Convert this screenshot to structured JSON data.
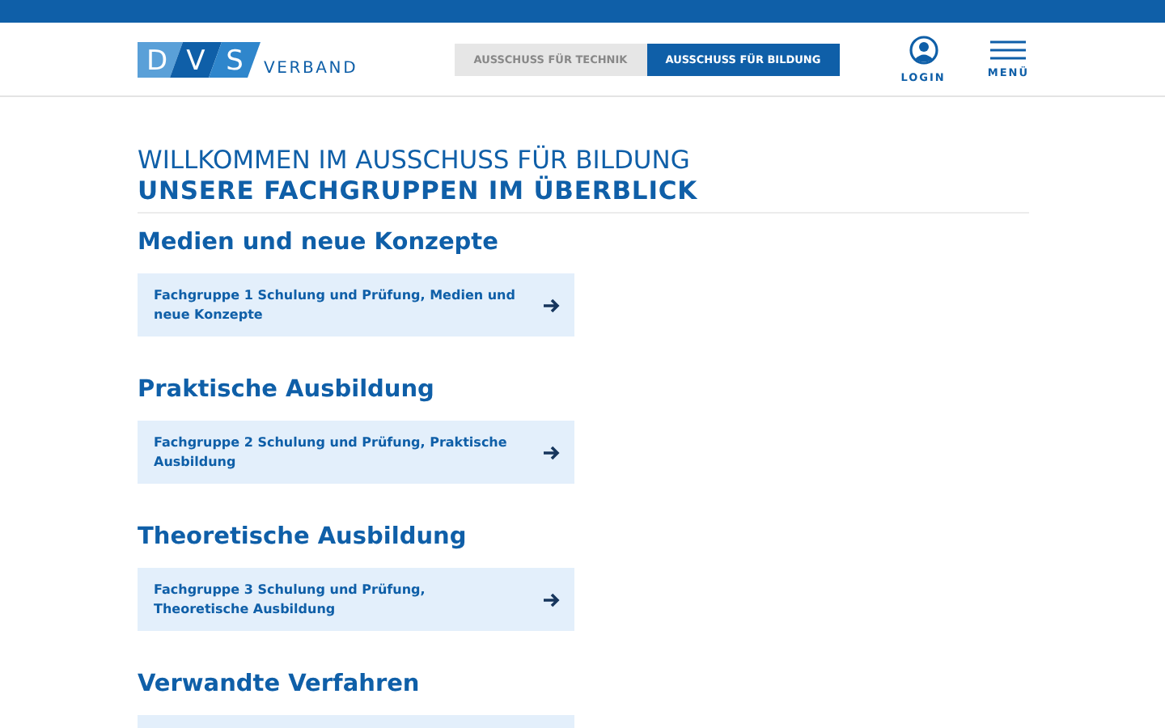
{
  "header": {
    "logo": {
      "letters": [
        "D",
        "V",
        "S"
      ],
      "word": "VERBAND"
    },
    "tabs": [
      {
        "label": "AUSSCHUSS FÜR TECHNIK",
        "selected": false
      },
      {
        "label": "AUSSCHUSS FÜR BILDUNG",
        "selected": true
      }
    ],
    "login": "LOGIN",
    "menu": "MENÜ"
  },
  "title": {
    "line1": "WILLKOMMEN IM AUSSCHUSS FÜR BILDUNG",
    "line2": "UNSERE FACHGRUPPEN IM ÜBERBLICK"
  },
  "sections": [
    {
      "heading": "Medien und neue Konzepte",
      "link": {
        "text": "Fachgruppe 1 Schulung und Prüfung, Medien und neue Konzepte"
      }
    },
    {
      "heading": "Praktische Ausbildung",
      "link": {
        "text": "Fachgruppe 2 Schulung und Prüfung, Praktische Ausbildung"
      }
    },
    {
      "heading": "Theoretische Ausbildung",
      "link": {
        "text": "Fachgruppe 3 Schulung und Prüfung, Theoretische Ausbildung"
      }
    },
    {
      "heading": "Verwandte Verfahren",
      "card_cut_off": true
    }
  ]
}
